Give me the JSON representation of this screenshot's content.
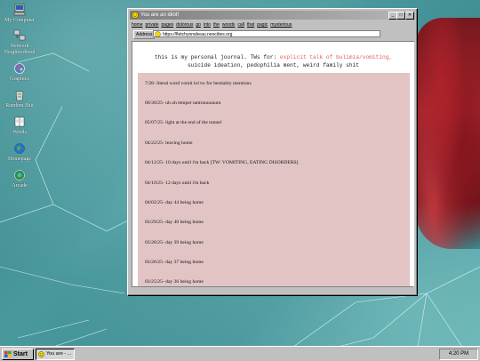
{
  "desktop": {
    "icons": [
      {
        "label": "My Computer",
        "icon": "computer-icon"
      },
      {
        "label": "Network Neighborhood",
        "icon": "network-icon"
      },
      {
        "label": "Graphics",
        "icon": "graphics-icon"
      },
      {
        "label": "Random Shit",
        "icon": "recycle-bin-icon"
      },
      {
        "label": "Words",
        "icon": "book-icon"
      },
      {
        "label": "Homepage",
        "icon": "globe-icon"
      },
      {
        "label": "Arcade",
        "icon": "arcade-icon"
      }
    ]
  },
  "window": {
    "title": "You are an idiot!",
    "menu": [
      "home",
      "private",
      "pages",
      "dolorous",
      "go",
      "into",
      "the",
      "woods",
      "call",
      "that",
      "pagic",
      "mysterious"
    ],
    "address_label": "Address",
    "address_value": "https://fletchyonsbeau.neocities.org",
    "header_line1": "this is my personal journal. TWs for: ",
    "header_warning": "explicit talk of bulimia/vomiting,",
    "header_line2": "suicide ideation, pedophilia ment, weird family shit",
    "entries": [
      "7/28- literal word vomit lol tw for bestiality mentions",
      "06/30/25- uh oh temper tantruuuuuum",
      "05/07/25- light at the end of the tunnel",
      "04/22/25- leaving home",
      "04/12/25- 10 days until i'm back [TW: VOMITING, EATING DISORDERS]",
      "04/10/25- 12 days until i'm back",
      "04/02/25- day 44 being home",
      "03/29/25- day 40 being home",
      "03/28/25- day 39 being home",
      "03/26/25- day 37 being home",
      "03/25/25- day 36 being home"
    ]
  },
  "taskbar": {
    "start_label": "Start",
    "task_label": "You are - ...",
    "clock": "4:20 PM"
  },
  "colors": {
    "desktop_teal": "#3f8a8f",
    "entries_bg": "#e2c4c4",
    "warning_red": "#e0605e"
  }
}
